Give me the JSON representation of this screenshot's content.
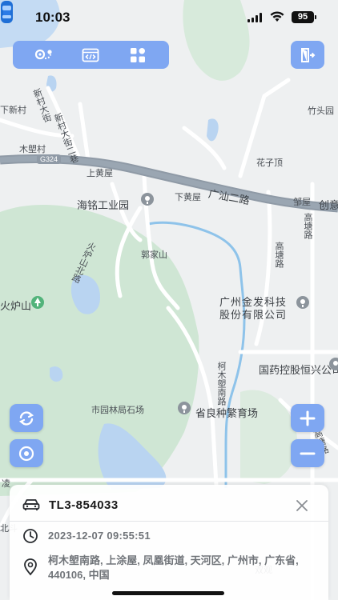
{
  "status_bar": {
    "time": "10:03",
    "battery": "95"
  },
  "toolbar": {
    "buttons": [
      {
        "icon": "route-location-icon"
      },
      {
        "icon": "code-window-icon"
      },
      {
        "icon": "grid-apps-icon"
      }
    ],
    "exit_icon": "exit-door-icon"
  },
  "map": {
    "road_badge": "G324",
    "labels": {
      "xiaxin_village": "下新村",
      "xincun_street": "新村大街",
      "xincun_street_2": "新村大街二巷",
      "mulian_village": "木塱村",
      "shangdahuangwu": "上黄屋",
      "xiahuangwu": "下黄屋",
      "guangshan_road": "广汕二路",
      "chuangxin": "创意",
      "zhutouyuan": "竹头园",
      "huazi_ding": "花子顶",
      "qiu": "邹屋",
      "gaotang_road": "高塘路",
      "gaotang_road_2": "高塘路",
      "hailan_industrial_park": "海铭工业园",
      "kuojiashan": "郭家山",
      "huolushan_north_road": "火炉山北路",
      "huolushan": "火炉山",
      "guangzhou_jinfa": "广州金发科技股份有限公司",
      "sinopharm": "国药控股恒兴公司",
      "kemu_south_road": "柯木塱南路",
      "forestry_stone_farm": "市园林局石场",
      "seed_breeding_farm": "省良种繁育场",
      "gaotang_road_3": "高塘路",
      "lingbei": "凌",
      "beidou": "北斗",
      "wo_park": "双观"
    }
  },
  "controls": {
    "refresh_icon": "refresh-icon",
    "locate_icon": "locate-target-icon",
    "zoom_in_icon": "plus-icon",
    "zoom_out_icon": "minus-icon"
  },
  "info_card": {
    "plate": "TL3-854033",
    "timestamp": "2023-12-07 09:55:51",
    "address": "柯木塱南路, 上涂屋, 凤凰街道, 天河区, 广州市, 广东省, 440106, 中国"
  },
  "colors": {
    "accent": "#7fa7f2",
    "green_area": "#cfe6d4",
    "water": "#b9d4f1",
    "highway": "#8f9aa6"
  }
}
